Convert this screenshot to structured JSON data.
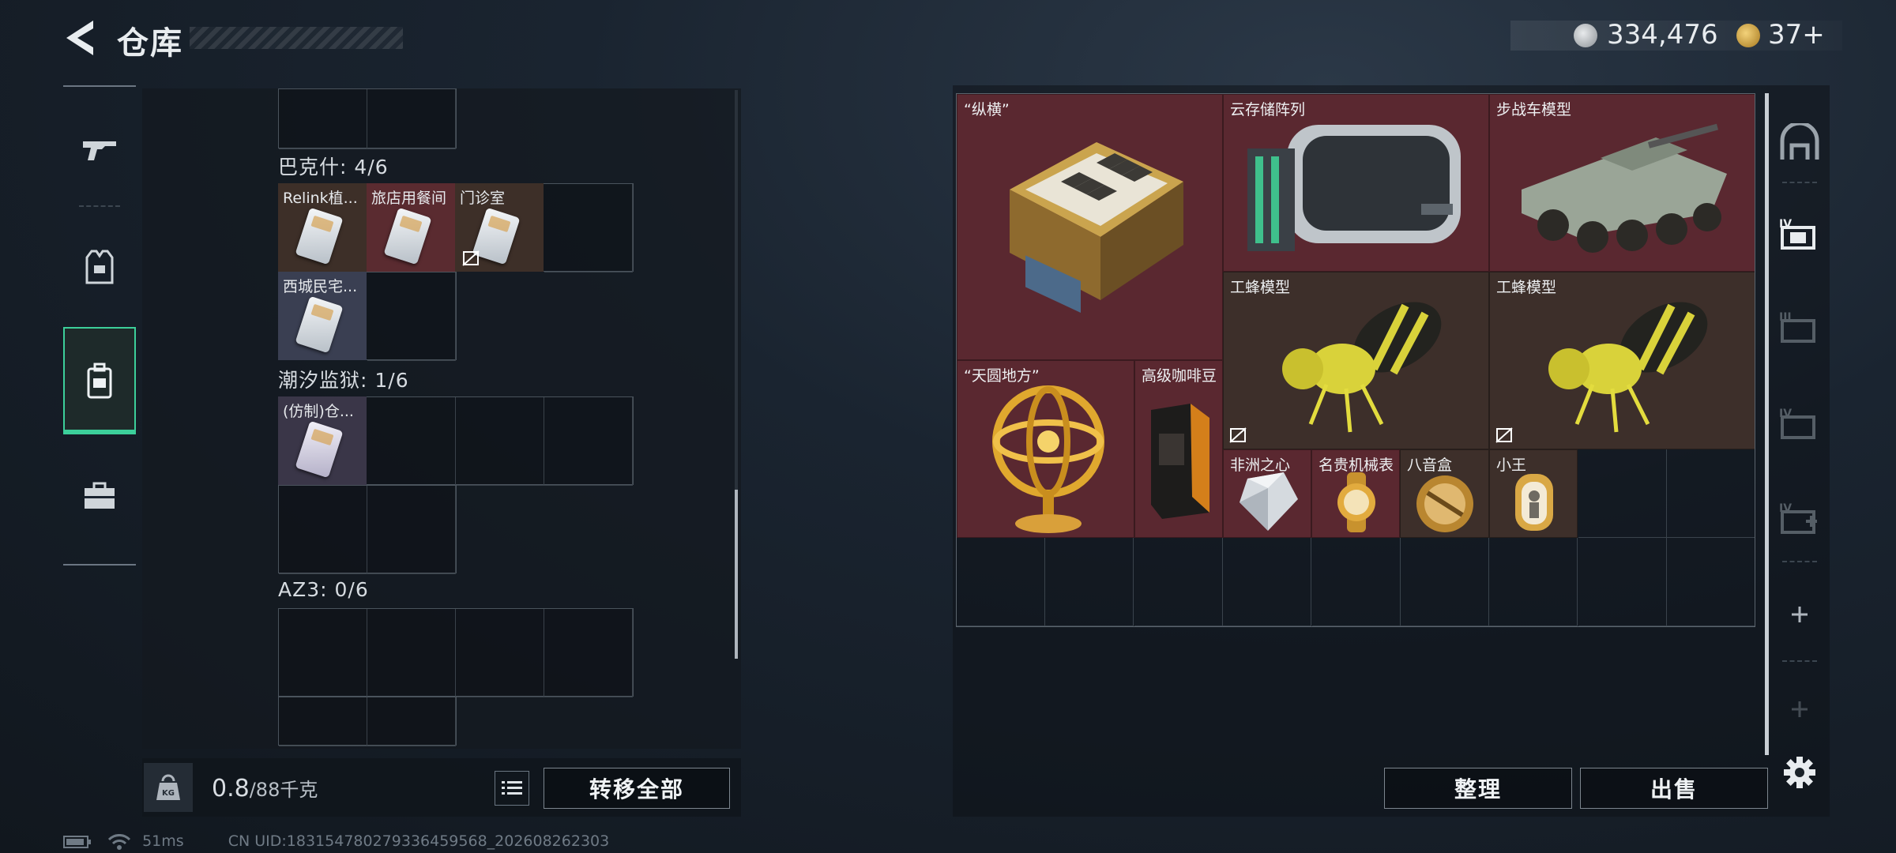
{
  "header": {
    "title": "仓库"
  },
  "currency": {
    "silver": "334,476",
    "gold": "37+"
  },
  "sidebar": {
    "items": [
      {
        "name": "weapons"
      },
      {
        "name": "armor"
      },
      {
        "name": "containers"
      },
      {
        "name": "toolbox"
      }
    ]
  },
  "left": {
    "sections": [
      {
        "label": "巴克什: 4/6"
      },
      {
        "label": "潮汐监狱: 1/6"
      },
      {
        "label": "AZ3: 0/6"
      }
    ],
    "items": {
      "relink": "Relink植...",
      "hotel": "旅店用餐间",
      "clinic": "门诊室",
      "xicheng": "西城民宅...",
      "replica": "(仿制)仓..."
    },
    "weight_value": "0.8",
    "weight_unit": "/88千克",
    "transfer_all": "转移全部"
  },
  "stash": {
    "items": {
      "chess": "“纵横”",
      "cloud": "云存储阵列",
      "ifv": "步战车模型",
      "bee1": "工蜂模型",
      "bee2": "工蜂模型",
      "armillary": "“天圆地方”",
      "coffee": "高级咖啡豆",
      "heart": "非洲之心",
      "watch": "名贵机械表",
      "musicbox": "八音盒",
      "king": "小王"
    },
    "sort_label": "整理",
    "sell_label": "出售"
  },
  "status": {
    "ping": "51ms",
    "uid": "CN UID:1831547802793364595​68_202608262303"
  }
}
